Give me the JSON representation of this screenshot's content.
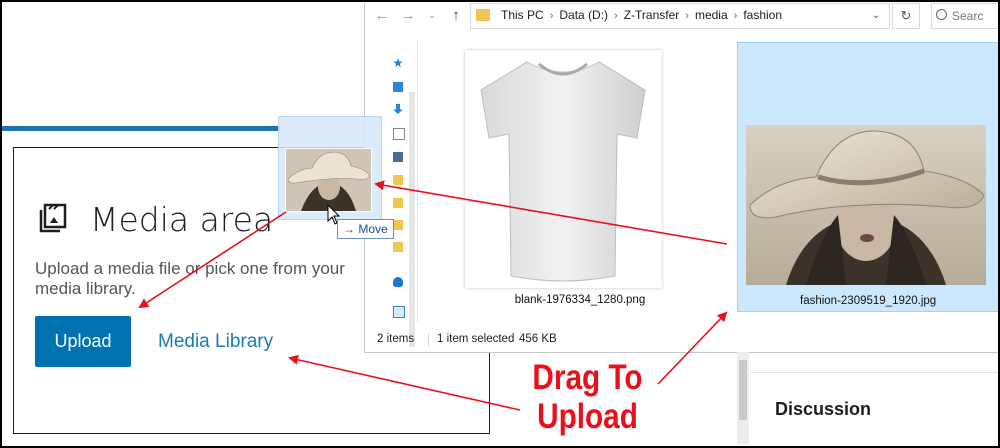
{
  "editor": {
    "media_title": "Media area",
    "media_desc": "Upload a media file or pick one from your media library.",
    "upload_label": "Upload",
    "library_label": "Media Library",
    "discussion_label": "Discussion"
  },
  "drag": {
    "move_label": "Move"
  },
  "explorer": {
    "breadcrumbs": [
      "This PC",
      "Data (D:)",
      "Z-Transfer",
      "media",
      "fashion"
    ],
    "search_placeholder": "Searc",
    "files": [
      {
        "name": "blank-1976334_1280.png",
        "selected": false
      },
      {
        "name": "fashion-2309519_1920.jpg",
        "selected": true
      }
    ],
    "status": {
      "items_count": "2 items",
      "selection": "1 item selected",
      "size": "456 KB"
    }
  },
  "annotation": {
    "line1": "Drag To",
    "line2": "Upload",
    "color": "#e8101b"
  },
  "colors": {
    "accent": "#0072b0",
    "link": "#1a7ab3",
    "selection": "#cce8ff"
  }
}
